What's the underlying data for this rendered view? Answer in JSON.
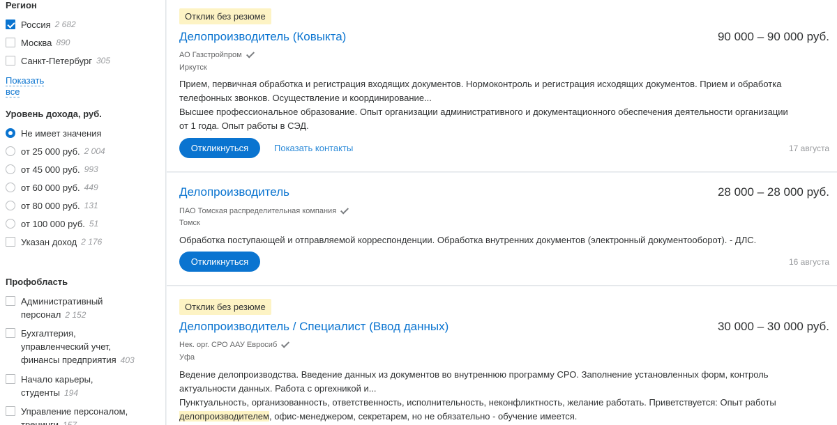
{
  "sidebar": {
    "region": {
      "title": "Регион",
      "options": [
        {
          "label": "Россия",
          "count": "2 682",
          "checked": true
        },
        {
          "label": "Москва",
          "count": "890",
          "checked": false
        },
        {
          "label": "Санкт-Петербург",
          "count": "305",
          "checked": false
        }
      ],
      "show_all": "Показать все"
    },
    "income": {
      "title": "Уровень дохода, руб.",
      "options": [
        {
          "label": "Не имеет значения",
          "count": "",
          "selected": true
        },
        {
          "label": "от 25 000 руб.",
          "count": "2 004"
        },
        {
          "label": "от 45 000 руб.",
          "count": "993"
        },
        {
          "label": "от 60 000 руб.",
          "count": "449"
        },
        {
          "label": "от 80 000 руб.",
          "count": "131"
        },
        {
          "label": "от 100 000 руб.",
          "count": "51"
        }
      ],
      "with_salary": {
        "label": "Указан доход",
        "count": "2 176"
      }
    },
    "profarea": {
      "title": "Профобласть",
      "options": [
        {
          "label_line1": "Административный",
          "label_line2": "персонал",
          "count": "2 152"
        },
        {
          "label_line1": "Бухгалтерия,",
          "label_line2": "управленческий учет,",
          "label_line3": "финансы предприятия",
          "count": "403"
        },
        {
          "label_line1": "Начало карьеры,",
          "label_line2": "студенты",
          "count": "194"
        },
        {
          "label_line1": "Управление персоналом,",
          "label_line2": "тренинги",
          "count": "157"
        }
      ]
    }
  },
  "vacancies": [
    {
      "badge": "Отклик без резюме",
      "title": "Делопроизводитель (Ковыкта)",
      "salary": "90 000 – 90 000 руб.",
      "company": "АО Газстройпром",
      "city": "Иркутск",
      "resp_line1": "Прием, первичная обработка и регистрация входящих документов. Нормоконтроль и регистрация исходящих документов. Прием и обработка",
      "resp_line2": "телефонных звонков. Осуществление и координирование...",
      "req_line1": "Высшее профессиональное образование. Опыт организации административного и документационного обеспечения деятельности организации",
      "req_line2": "от 1 года. Опыт работы в СЭД.",
      "respond": "Откликнуться",
      "contacts": "Показать контакты",
      "date": "17 августа"
    },
    {
      "title": "Делопроизводитель",
      "salary": "28 000 – 28 000 руб.",
      "company": "ПАО Томская распределительная компания",
      "city": "Томск",
      "resp_line1": "Обработка поступающей и отправляемой корреспонденции. Обработка внутренних документов (электронный документооборот). - ДЛС.",
      "respond": "Откликнуться",
      "date": "16 августа"
    },
    {
      "badge": "Отклик без резюме",
      "title": "Делопроизводитель / Специалист (Ввод данных)",
      "salary": "30 000 – 30 000 руб.",
      "company": "Нек. орг. СРО ААУ Евросиб",
      "city": "Уфа",
      "resp_line1": "Ведение делопроизводства. Введение данных из документов во внутреннюю программу СРО. Заполнение установленных форм, контроль",
      "resp_line2": "актуальности данных. Работа с оргехникой и...",
      "req_line1": "Пунктуальность, организованность, ответственность, исполнительность, неконфликтность, желание работать. Приветствуется: Опыт работы",
      "req_line2_hl": "делопроизводителем",
      "req_line2_rest": ", офис-менеджером, секретарем, но не обязательно - обучение имеется."
    }
  ],
  "colors": {
    "accent": "#0a74d0",
    "badge_bg": "#fdf3c4",
    "muted": "#999b9e"
  }
}
